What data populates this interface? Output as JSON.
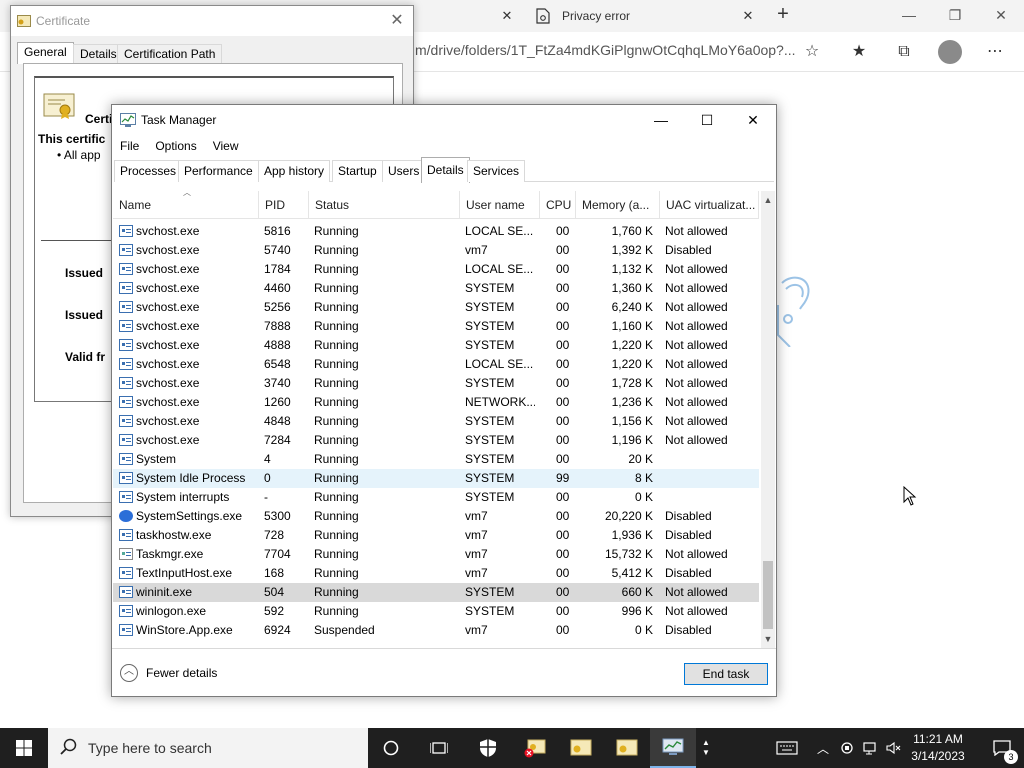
{
  "browser": {
    "tabs": [
      {
        "label": "Privacy error",
        "active": true
      }
    ],
    "url": "m/drive/folders/1T_FtZa4mdKGiPlgnwOtCqhqLMoY6a0op?...",
    "colors": {
      "tabbar": "#f3f3f3"
    }
  },
  "certificate": {
    "title": "Certificate",
    "tabs": [
      "General",
      "Details",
      "Certification Path"
    ],
    "info_heading": "Certificate Information",
    "purpose_prefix": "This certific",
    "bullet": "• All app",
    "issued_to": "Issued",
    "issued_by": "Issued",
    "valid_from": "Valid fr"
  },
  "task_manager": {
    "title": "Task Manager",
    "menu": [
      "File",
      "Options",
      "View"
    ],
    "tabs": [
      "Processes",
      "Performance",
      "App history",
      "Startup",
      "Users",
      "Details",
      "Services"
    ],
    "active_tab": "Details",
    "columns": [
      "Name",
      "PID",
      "Status",
      "User name",
      "CPU",
      "Memory (a...",
      "UAC virtualizat..."
    ],
    "rows": [
      {
        "name": "svchost.exe",
        "pid": "5816",
        "status": "Running",
        "user": "LOCAL SE...",
        "cpu": "00",
        "mem": "1,760 K",
        "uac": "Not allowed",
        "icon": "service-icon"
      },
      {
        "name": "svchost.exe",
        "pid": "5740",
        "status": "Running",
        "user": "vm7",
        "cpu": "00",
        "mem": "1,392 K",
        "uac": "Disabled",
        "icon": "service-icon"
      },
      {
        "name": "svchost.exe",
        "pid": "1784",
        "status": "Running",
        "user": "LOCAL SE...",
        "cpu": "00",
        "mem": "1,132 K",
        "uac": "Not allowed",
        "icon": "service-icon"
      },
      {
        "name": "svchost.exe",
        "pid": "4460",
        "status": "Running",
        "user": "SYSTEM",
        "cpu": "00",
        "mem": "1,360 K",
        "uac": "Not allowed",
        "icon": "service-icon"
      },
      {
        "name": "svchost.exe",
        "pid": "5256",
        "status": "Running",
        "user": "SYSTEM",
        "cpu": "00",
        "mem": "6,240 K",
        "uac": "Not allowed",
        "icon": "service-icon"
      },
      {
        "name": "svchost.exe",
        "pid": "7888",
        "status": "Running",
        "user": "SYSTEM",
        "cpu": "00",
        "mem": "1,160 K",
        "uac": "Not allowed",
        "icon": "service-icon"
      },
      {
        "name": "svchost.exe",
        "pid": "4888",
        "status": "Running",
        "user": "SYSTEM",
        "cpu": "00",
        "mem": "1,220 K",
        "uac": "Not allowed",
        "icon": "service-icon"
      },
      {
        "name": "svchost.exe",
        "pid": "6548",
        "status": "Running",
        "user": "LOCAL SE...",
        "cpu": "00",
        "mem": "1,220 K",
        "uac": "Not allowed",
        "icon": "service-icon"
      },
      {
        "name": "svchost.exe",
        "pid": "3740",
        "status": "Running",
        "user": "SYSTEM",
        "cpu": "00",
        "mem": "1,728 K",
        "uac": "Not allowed",
        "icon": "service-icon"
      },
      {
        "name": "svchost.exe",
        "pid": "1260",
        "status": "Running",
        "user": "NETWORK...",
        "cpu": "00",
        "mem": "1,236 K",
        "uac": "Not allowed",
        "icon": "service-icon"
      },
      {
        "name": "svchost.exe",
        "pid": "4848",
        "status": "Running",
        "user": "SYSTEM",
        "cpu": "00",
        "mem": "1,156 K",
        "uac": "Not allowed",
        "icon": "service-icon"
      },
      {
        "name": "svchost.exe",
        "pid": "7284",
        "status": "Running",
        "user": "SYSTEM",
        "cpu": "00",
        "mem": "1,196 K",
        "uac": "Not allowed",
        "icon": "service-icon"
      },
      {
        "name": "System",
        "pid": "4",
        "status": "Running",
        "user": "SYSTEM",
        "cpu": "00",
        "mem": "20 K",
        "uac": "",
        "icon": "service-icon"
      },
      {
        "name": "System Idle Process",
        "pid": "0",
        "status": "Running",
        "user": "SYSTEM",
        "cpu": "99",
        "mem": "8 K",
        "uac": "",
        "icon": "service-icon",
        "state": "hover"
      },
      {
        "name": "System interrupts",
        "pid": "-",
        "status": "Running",
        "user": "SYSTEM",
        "cpu": "00",
        "mem": "0 K",
        "uac": "",
        "icon": "service-icon"
      },
      {
        "name": "SystemSettings.exe",
        "pid": "5300",
        "status": "Running",
        "user": "vm7",
        "cpu": "00",
        "mem": "20,220 K",
        "uac": "Disabled",
        "icon": "gear-icon"
      },
      {
        "name": "taskhostw.exe",
        "pid": "728",
        "status": "Running",
        "user": "vm7",
        "cpu": "00",
        "mem": "1,936 K",
        "uac": "Disabled",
        "icon": "service-icon"
      },
      {
        "name": "Taskmgr.exe",
        "pid": "7704",
        "status": "Running",
        "user": "vm7",
        "cpu": "00",
        "mem": "15,732 K",
        "uac": "Not allowed",
        "icon": "chart-icon"
      },
      {
        "name": "TextInputHost.exe",
        "pid": "168",
        "status": "Running",
        "user": "vm7",
        "cpu": "00",
        "mem": "5,412 K",
        "uac": "Disabled",
        "icon": "service-icon"
      },
      {
        "name": "wininit.exe",
        "pid": "504",
        "status": "Running",
        "user": "SYSTEM",
        "cpu": "00",
        "mem": "660 K",
        "uac": "Not allowed",
        "icon": "service-icon",
        "state": "selected"
      },
      {
        "name": "winlogon.exe",
        "pid": "592",
        "status": "Running",
        "user": "SYSTEM",
        "cpu": "00",
        "mem": "996 K",
        "uac": "Not allowed",
        "icon": "service-icon"
      },
      {
        "name": "WinStore.App.exe",
        "pid": "6924",
        "status": "Suspended",
        "user": "vm7",
        "cpu": "00",
        "mem": "0 K",
        "uac": "Disabled",
        "icon": "service-icon"
      }
    ],
    "fewer_details": "Fewer details",
    "end_task": "End task",
    "colors": {
      "selected_row": "#d9d9d9",
      "hover_row": "#e5f3fb",
      "accent": "#0078d7"
    }
  },
  "taskbar": {
    "search_placeholder": "Type here to search",
    "time": "11:21 AM",
    "date": "3/14/2023",
    "notification_count": "3",
    "colors": {
      "background": "#1f1f1f"
    }
  }
}
